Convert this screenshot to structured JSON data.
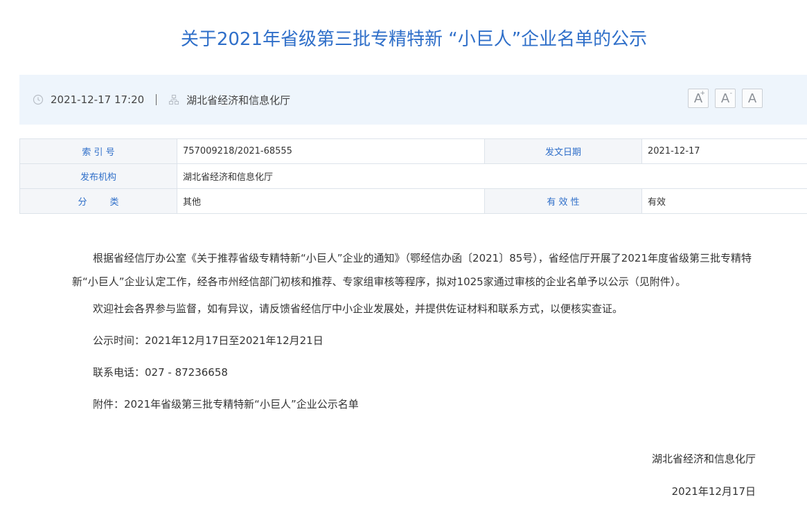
{
  "article": {
    "title": "关于2021年省级第三批专精特新 “小巨人”企业名单的公示",
    "datetime": "2021-12-17 17:20",
    "source": "湖北省经济和信息化厅"
  },
  "font_controls": {
    "increase": "A",
    "increase_mark": "+",
    "decrease": "A",
    "decrease_mark": "-",
    "reset": "A"
  },
  "info_table": {
    "index_label": "索 引 号",
    "index_value": "757009218/2021-68555",
    "date_label": "发文日期",
    "date_value": "2021-12-17",
    "org_label": "发布机构",
    "org_value": "湖北省经济和信息化厅",
    "category_label": "分        类",
    "category_value": "其他",
    "validity_label": "有 效 性",
    "validity_value": "有效"
  },
  "body": {
    "paragraph1": "根据省经信厅办公室《关于推荐省级专精特新“小巨人”企业的通知》（鄂经信办函〔2021〕85号），省经信厅开展了2021年度省级第三批专精特新“小巨人”企业认定工作，经各市州经信部门初核和推荐、专家组审核等程序，拟对1025家通过审核的企业名单予以公示（见附件）。",
    "paragraph2": "欢迎社会各界参与监督，如有异议，请反馈省经信厅中小企业发展处，并提供佐证材料和联系方式，以便核实查证。",
    "period": "公示时间：2021年12月17日至2021年12月21日",
    "phone": "联系电话：027 - 87236658",
    "attachment": "附件：2021年省级第三批专精特新“小巨人”企业公示名单"
  },
  "signature": {
    "org": "湖北省经济和信息化厅",
    "date": "2021年12月17日"
  },
  "colors": {
    "title": "#2f6fc9",
    "meta_background": "#eef5fc",
    "table_label": "#2f6fc9",
    "table_label_background": "#f4f6f9"
  }
}
